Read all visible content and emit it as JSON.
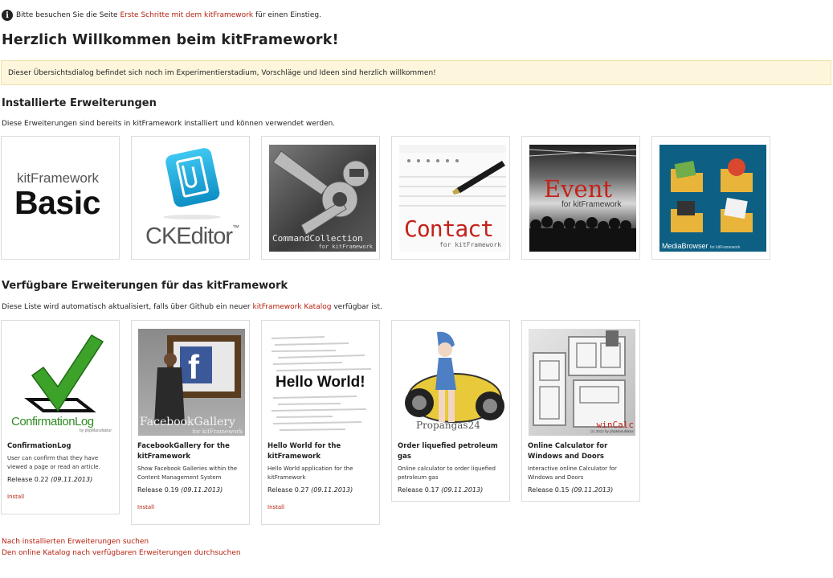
{
  "info": {
    "prefix": "Bitte besuchen Sie die Seite",
    "link": "Erste Schritte mit dem kitFramework",
    "suffix": "für einen Einstieg."
  },
  "title": "Herzlich Willkommen beim kitFramework!",
  "notice": "Dieser Übersichtsdialog befindet sich noch im Experimentierstadium, Vorschläge und Ideen sind herzlich willkommen!",
  "installed": {
    "heading": "Installierte Erweiterungen",
    "description": "Diese Erweiterungen sind bereits in kitFramework installiert und können verwendet werden.",
    "tiles": [
      {
        "icon": "kitframework-basic-logo",
        "line1": "kitFramework",
        "line2": "Basic"
      },
      {
        "icon": "ckeditor-logo",
        "label": "CKEditor",
        "tm": "™"
      },
      {
        "icon": "wrench-photo",
        "label": "CommandCollection",
        "sub": "for kitFramework"
      },
      {
        "icon": "notepad-pen-photo",
        "label": "Contact",
        "sub": "for kitFramework"
      },
      {
        "icon": "concert-crowd-photo",
        "label": "Event",
        "sub": "for kitFramework"
      },
      {
        "icon": "media-folders-icon",
        "label": "MediaBrowser",
        "sub": "for kitFramework"
      }
    ]
  },
  "available": {
    "heading": "Verfügbare Erweiterungen für das kitFramework",
    "desc_prefix": "Diese Liste wird automatisch aktualisiert, falls über Github ein neuer",
    "desc_link": "kitFramework Katalog",
    "desc_suffix": "verfügbar ist.",
    "cards": [
      {
        "icon": "checkmark-logo",
        "img_label": "ConfirmationLog",
        "img_sub": "by phpManufaktur",
        "title": "ConfirmationLog",
        "desc": "User can confirm that they have viewed a page or read an article.",
        "release": "Release 0.22",
        "date": "(09.11.2013)",
        "install": "Install"
      },
      {
        "icon": "facebook-gallery-photo",
        "img_label": "FacebookGallery",
        "img_sub": "for kitFramework",
        "title": "FacebookGallery for the kitFramework",
        "desc": "Show Facebook Galleries within the Content Management System",
        "release": "Release 0.19",
        "date": "(09.11.2013)",
        "install": "Install"
      },
      {
        "icon": "hello-world-code",
        "img_label": "Hello World!",
        "title": "Hello World for the kitFramework",
        "desc": "Hello World application for the kitFramework",
        "release": "Release 0.27",
        "date": "(09.11.2013)",
        "install": "Install"
      },
      {
        "icon": "propangas-illustration",
        "img_label": "Propangas24",
        "title": "Order liquefied petroleum gas",
        "desc": "Online calculator to order liquefied petroleum gas",
        "release": "Release 0.17",
        "date": "(09.11.2013)"
      },
      {
        "icon": "window-profile-photo",
        "img_label": "winCalc",
        "img_sub": "(c) 2012 by phpManufaktur",
        "title": "Online Calculator for Windows and Doors",
        "desc": "Interactive online Calculator for Windows and Doors",
        "release": "Release 0.15",
        "date": "(09.11.2013)"
      }
    ]
  },
  "links": {
    "search_installed": "Nach installierten Erweiterungen suchen",
    "search_catalog": "Den online Katalog nach verfügbaren Erweiterungen durchsuchen"
  },
  "colors": {
    "link": "#b5210f",
    "notice_bg": "#fdf6dc",
    "notice_border": "#efdfa6",
    "tile_border": "#dcdcdc"
  }
}
